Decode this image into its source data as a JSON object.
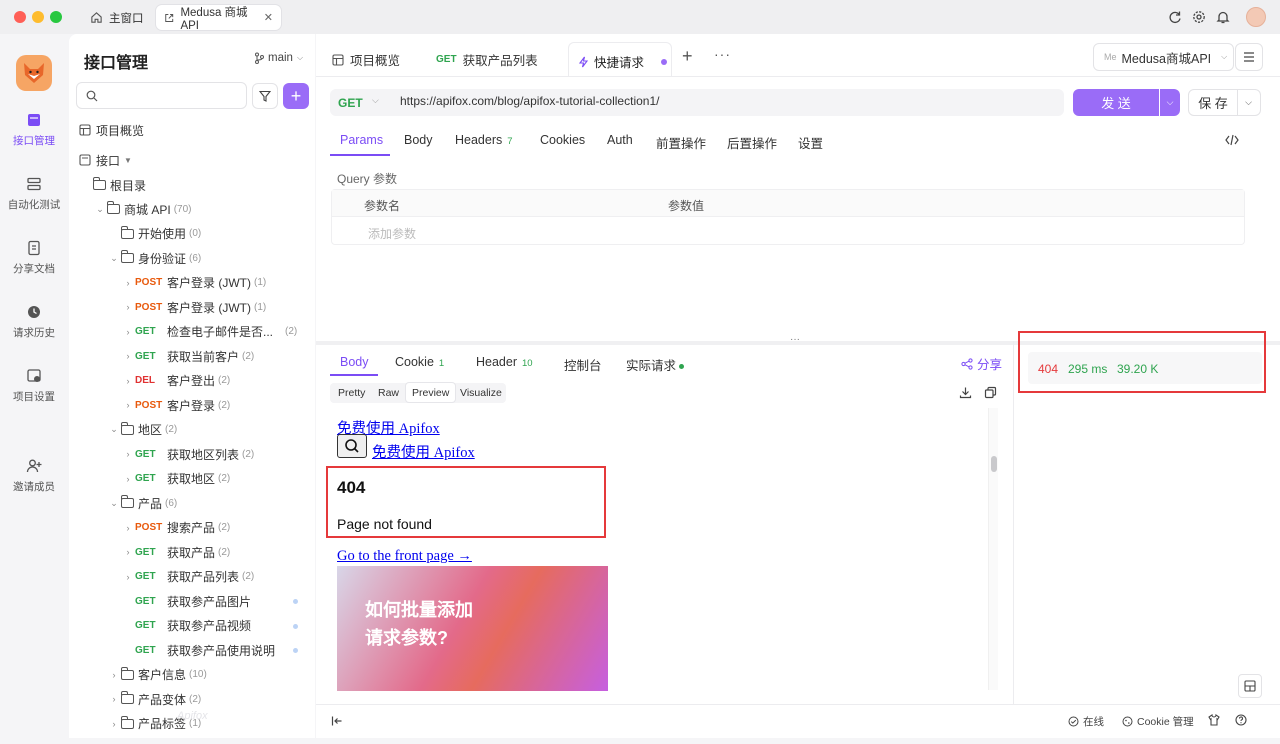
{
  "titlebar": {
    "tabs": [
      {
        "label": "主窗口"
      },
      {
        "label": "Medusa 商城 API"
      }
    ]
  },
  "rail": {
    "items": [
      {
        "label": "接口管理"
      },
      {
        "label": "自动化测试"
      },
      {
        "label": "分享文档"
      },
      {
        "label": "请求历史"
      },
      {
        "label": "项目设置"
      },
      {
        "label": "邀请成员"
      }
    ]
  },
  "sidebar": {
    "title": "接口管理",
    "branch": "main",
    "search_placeholder": "",
    "overview": "项目概览",
    "interfaces": "接口",
    "root": "根目录",
    "tree": [
      {
        "type": "folder",
        "label": "商城 API",
        "count": "(70)"
      },
      {
        "type": "folder",
        "label": "开始使用",
        "count": "(0)"
      },
      {
        "type": "folder",
        "label": "身份验证",
        "count": "(6)"
      },
      {
        "type": "api",
        "method": "POST",
        "label": "客户登录 (JWT)",
        "count": "(1)"
      },
      {
        "type": "api",
        "method": "POST",
        "label": "客户登录 (JWT)",
        "count": "(1)"
      },
      {
        "type": "api",
        "method": "GET",
        "label": "检查电子邮件是否...",
        "count": "(2)"
      },
      {
        "type": "api",
        "method": "GET",
        "label": "获取当前客户",
        "count": "(2)"
      },
      {
        "type": "api",
        "method": "DEL",
        "label": "客户登出",
        "count": "(2)"
      },
      {
        "type": "api",
        "method": "POST",
        "label": "客户登录",
        "count": "(2)"
      },
      {
        "type": "folder",
        "label": "地区",
        "count": "(2)"
      },
      {
        "type": "api",
        "method": "GET",
        "label": "获取地区列表",
        "count": "(2)"
      },
      {
        "type": "api",
        "method": "GET",
        "label": "获取地区",
        "count": "(2)"
      },
      {
        "type": "folder",
        "label": "产品",
        "count": "(6)"
      },
      {
        "type": "api",
        "method": "POST",
        "label": "搜索产品",
        "count": "(2)"
      },
      {
        "type": "api",
        "method": "GET",
        "label": "获取产品",
        "count": "(2)"
      },
      {
        "type": "api",
        "method": "GET",
        "label": "获取产品列表",
        "count": "(2)"
      },
      {
        "type": "api",
        "method": "GET",
        "label": "获取参产品图片",
        "count": ""
      },
      {
        "type": "api",
        "method": "GET",
        "label": "获取参产品视频",
        "count": ""
      },
      {
        "type": "api",
        "method": "GET",
        "label": "获取参产品使用说明",
        "count": ""
      },
      {
        "type": "folder",
        "label": "客户信息",
        "count": "(10)"
      },
      {
        "type": "folder",
        "label": "产品变体",
        "count": "(2)"
      },
      {
        "type": "folder",
        "label": "产品标签",
        "count": "(1)"
      }
    ],
    "watermark": "Apifox"
  },
  "tabs": {
    "items": [
      {
        "label": "项目概览"
      },
      {
        "method": "GET",
        "label": "获取产品列表"
      },
      {
        "label": "快捷请求"
      }
    ],
    "env": "Medusa商城API",
    "env_badge": "Me"
  },
  "request": {
    "method": "GET",
    "url": "https://apifox.com/blog/apifox-tutorial-collection1/",
    "send": "发 送",
    "save": "保 存"
  },
  "params_tabs": [
    {
      "label": "Params"
    },
    {
      "label": "Body"
    },
    {
      "label": "Headers",
      "badge": "7"
    },
    {
      "label": "Cookies"
    },
    {
      "label": "Auth"
    },
    {
      "label": "前置操作"
    },
    {
      "label": "后置操作"
    },
    {
      "label": "设置"
    }
  ],
  "query": {
    "title": "Query 参数",
    "col_name": "参数名",
    "col_value": "参数值",
    "add_placeholder": "添加参数"
  },
  "response_tabs": [
    {
      "label": "Body"
    },
    {
      "label": "Cookie",
      "badge": "1"
    },
    {
      "label": "Header",
      "badge": "10"
    },
    {
      "label": "控制台"
    },
    {
      "label": "实际请求"
    }
  ],
  "share": "分享",
  "view_modes": [
    "Pretty",
    "Raw",
    "Preview",
    "Visualize"
  ],
  "preview": {
    "link1": "免费使用 Apifox",
    "link2": "免费使用 Apifox",
    "h404": "404",
    "not_found": "Page not found",
    "front": "Go to the front page →",
    "banner_line1": "如何批量添加",
    "banner_line2": "请求参数?"
  },
  "status": {
    "code": "404",
    "time": "295 ms",
    "size": "39.20 K"
  },
  "footer": {
    "online": "在线",
    "cookie": "Cookie 管理"
  },
  "colors": {
    "accent": "#7b4cf5",
    "get": "#2fa44f",
    "post": "#e8590c",
    "delete": "#e03131",
    "status_error": "#e5393b"
  }
}
